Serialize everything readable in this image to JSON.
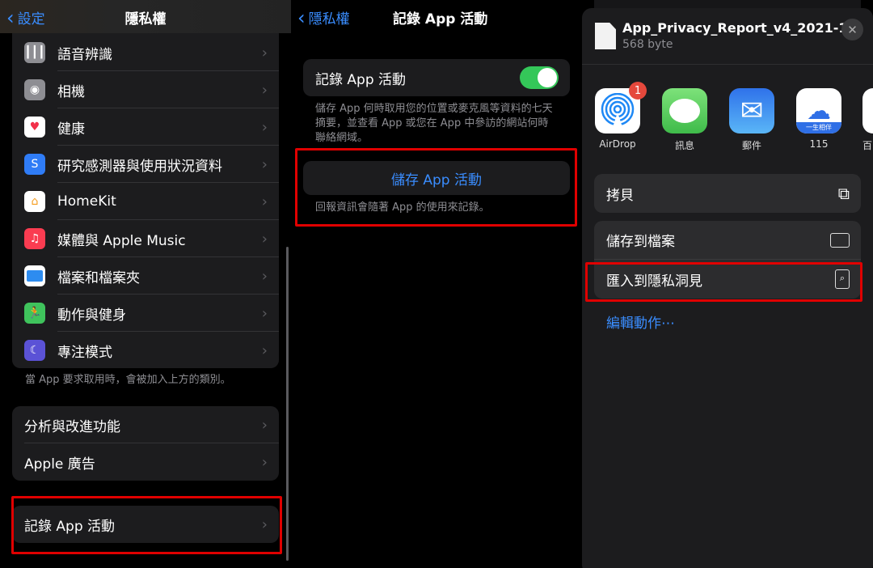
{
  "left": {
    "back_label": "設定",
    "title": "隱私權",
    "items": [
      {
        "label": "語音辨識",
        "icon": "waveform-icon"
      },
      {
        "label": "相機",
        "icon": "camera-icon"
      },
      {
        "label": "健康",
        "icon": "heart-icon"
      },
      {
        "label": "研究感測器與使用狀況資料",
        "icon": "research-icon"
      },
      {
        "label": "HomeKit",
        "icon": "home-icon"
      },
      {
        "label": "媒體與 Apple Music",
        "icon": "music-icon"
      },
      {
        "label": "檔案和檔案夾",
        "icon": "folder-icon"
      },
      {
        "label": "動作與健身",
        "icon": "fitness-icon"
      },
      {
        "label": "專注模式",
        "icon": "moon-icon"
      }
    ],
    "footnote": "當 App 要求取用時，會被加入上方的類別。",
    "group2": [
      {
        "label": "分析與改進功能"
      },
      {
        "label": "Apple 廣告"
      }
    ],
    "record_label": "記錄 App 活動"
  },
  "middle": {
    "back_label": "隱私權",
    "title": "記錄 App 活動",
    "toggle_label": "記錄 App 活動",
    "toggle_on": true,
    "description": "儲存 App 何時取用您的位置或麥克風等資料的七天摘要，並查看 App 或您在 App 中參訪的網站何時聯絡網域。",
    "save_button": "儲存 App 活動",
    "save_note": "回報資訊會隨著 App 的使用來記錄。"
  },
  "right": {
    "file_name": "App_Privacy_Report_v4_2021-1...",
    "file_size": "568 byte",
    "apps": [
      {
        "label": "AirDrop",
        "badge": "1"
      },
      {
        "label": "訊息"
      },
      {
        "label": "郵件"
      },
      {
        "label": "115",
        "banner": "一生相伴"
      },
      {
        "label": "百"
      }
    ],
    "actions": [
      {
        "label": "拷貝",
        "icon": "copy-icon"
      },
      {
        "label": "儲存到檔案",
        "icon": "folder-icon"
      },
      {
        "label": "匯入到隱私洞見",
        "icon": "privacy-insight-icon"
      }
    ],
    "edit_actions": "編輯動作⋯"
  },
  "colors": {
    "accent": "#3a8dff",
    "highlight": "#e00000",
    "toggle": "#34c759"
  }
}
